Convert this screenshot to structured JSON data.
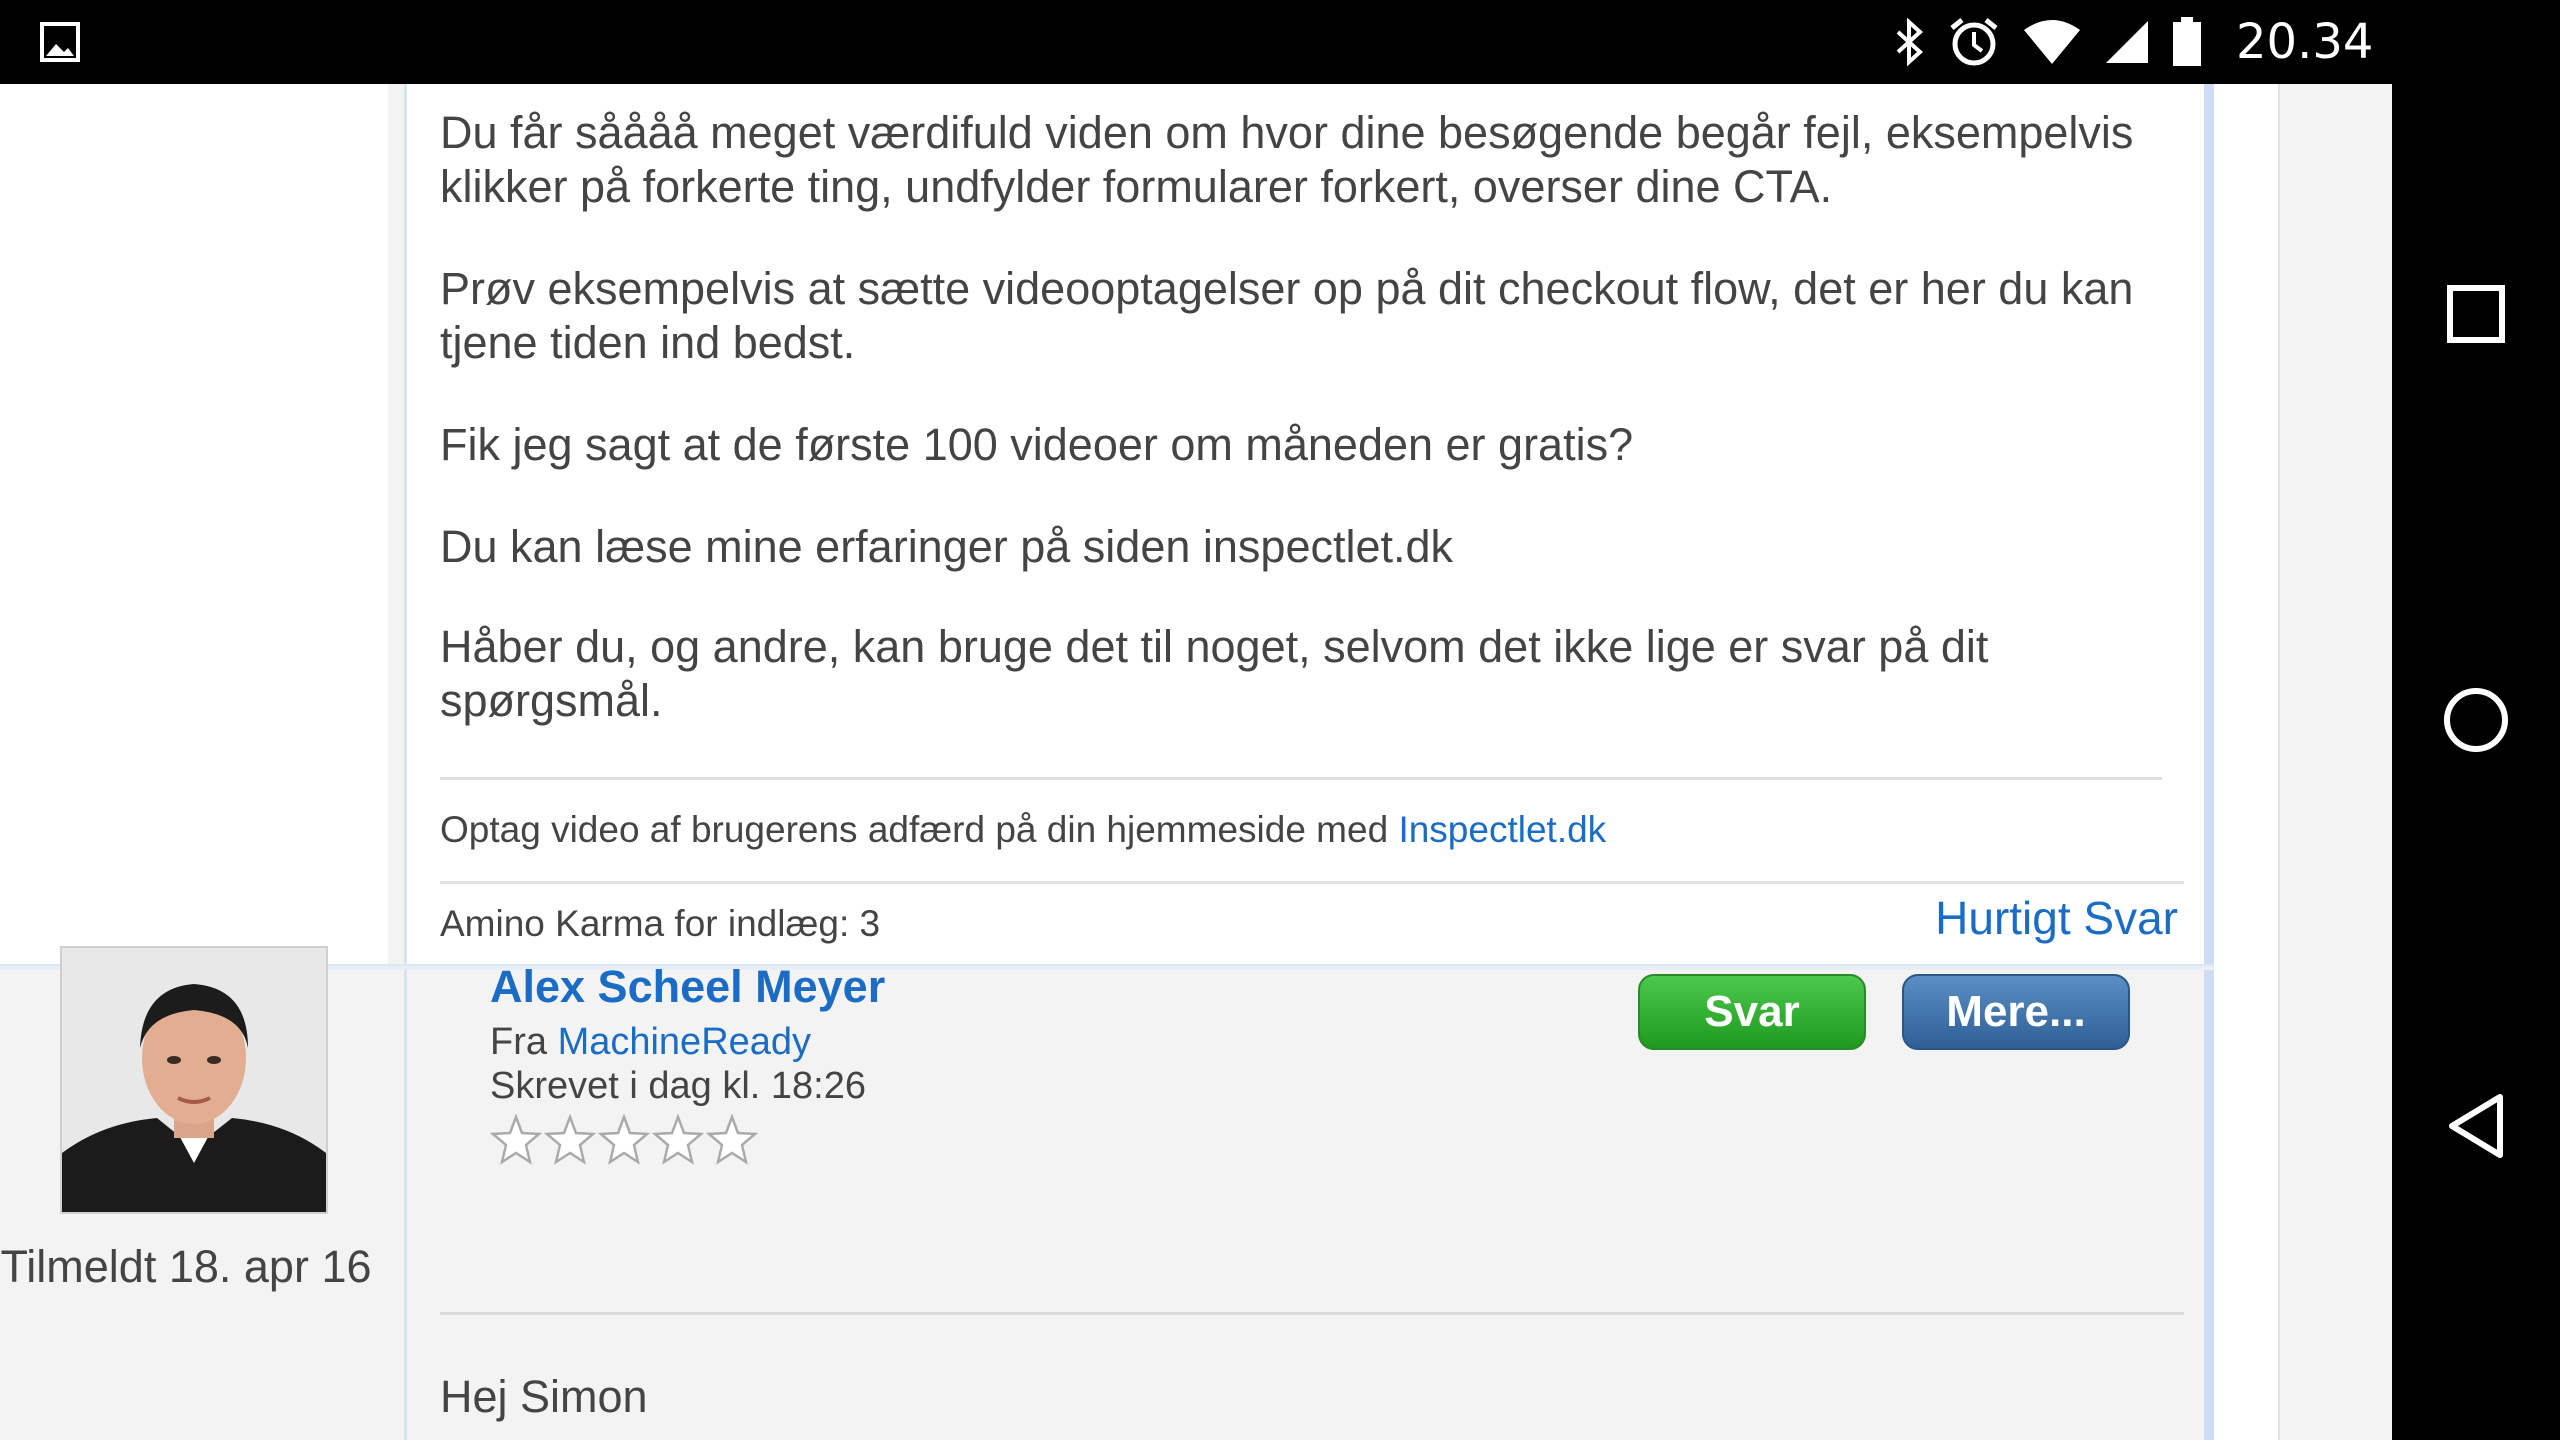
{
  "status_bar": {
    "time": "20.34",
    "icons": [
      "gallery-icon",
      "bluetooth-icon",
      "alarm-icon",
      "wifi-icon",
      "signal-icon",
      "battery-icon"
    ]
  },
  "nav_bar": {
    "buttons": [
      "recents-icon",
      "home-icon",
      "back-icon"
    ]
  },
  "post1": {
    "paragraphs": [
      "Du får såååå meget værdifuld viden om hvor dine besøgende begår fejl, eksempelvis klikker på forkerte ting, undfylder formularer forkert, overser dine CTA.",
      "Prøv eksempelvis at sætte videooptagelser op på dit checkout flow, det er her du kan tjene tiden ind bedst.",
      "Fik jeg sagt at de første 100 videoer om måneden er gratis?",
      "Du kan læse mine erfaringer på siden inspectlet.dk",
      "Håber du, og andre, kan bruge det til noget, selvom det ikke lige er svar på dit spørgsmål."
    ],
    "signature_text": "Optag video af brugerens adfærd på din hjemmeside med ",
    "signature_link": "Inspectlet.dk",
    "karma": "Amino Karma for indlæg: 3",
    "quick_reply": "Hurtigt Svar"
  },
  "post2": {
    "joined": "Tilmeldt 18. apr 16",
    "author": "Alex Scheel Meyer",
    "from_label": "Fra ",
    "from_link": "MachineReady",
    "written": "Skrevet i dag kl. 18:26",
    "rating": 0,
    "reply_button": "Svar",
    "more_button": "Mere...",
    "greeting": "Hej Simon"
  },
  "colors": {
    "link": "#1a6cc4",
    "reply_button": "#2fb12f",
    "more_button": "#3d6fa8"
  }
}
